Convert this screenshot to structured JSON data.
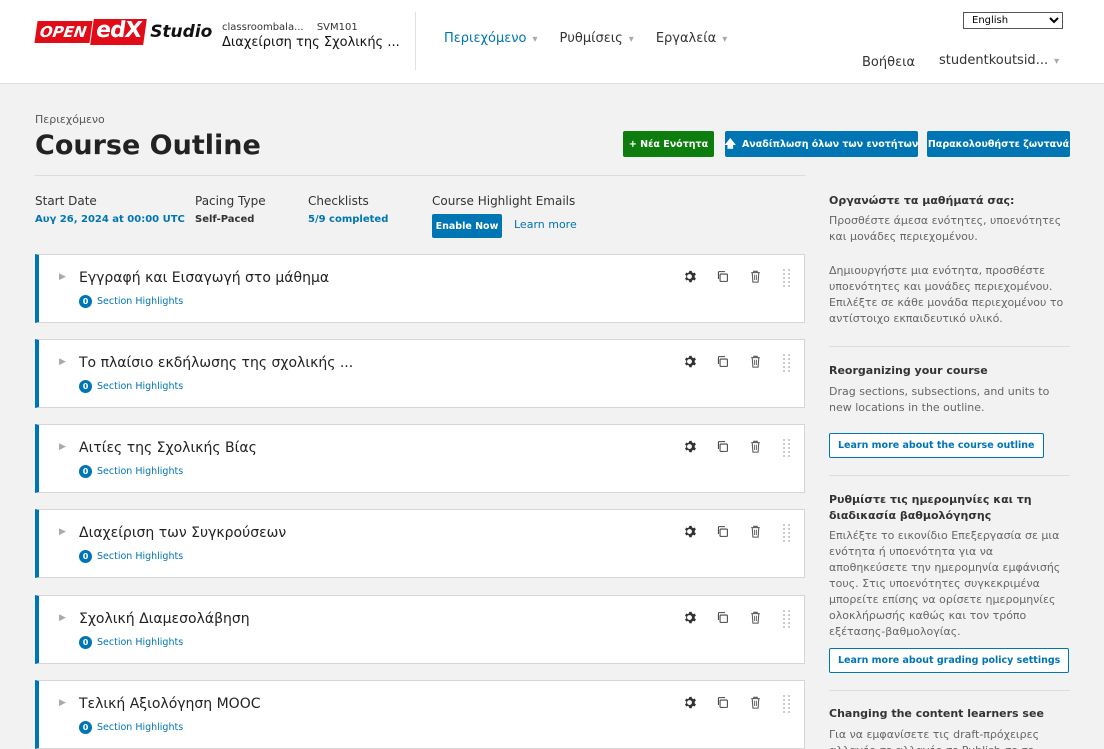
{
  "header": {
    "logo": {
      "open": "OPEN",
      "edx": "edX",
      "studio": "Studio"
    },
    "course_org": "classroombala...",
    "course_number": "SVM101",
    "course_title": "Διαχείριση της Σχολικής ...",
    "nav": [
      {
        "label": "Περιεχόμενο"
      },
      {
        "label": "Ρυθμίσεις"
      },
      {
        "label": "Εργαλεία"
      }
    ],
    "language": "English",
    "help": "Βοήθεια",
    "user": "studentkoutsid..."
  },
  "page": {
    "breadcrumb": "Περιεχόμενο",
    "title": "Course Outline",
    "new_section_btn": "+ Νέα Ενότητα",
    "collapse_all_btn": "Αναδίπλωση όλων των ενοτήτων",
    "view_live_btn": "Παρακολουθήστε ζωντανά"
  },
  "status": {
    "start_date_label": "Start Date",
    "start_date_value": "Αυγ 26, 2024 at 00:00 UTC",
    "pacing_label": "Pacing Type",
    "pacing_value": "Self-Paced",
    "checklists_label": "Checklists",
    "checklists_value": "5/9 completed",
    "highlight_label": "Course Highlight Emails",
    "enable_now": "Enable Now",
    "learn_more": "Learn more"
  },
  "sections": [
    {
      "title": "Εγγραφή και Εισαγωγή στο μάθημα",
      "highlights_count": "0",
      "highlights_label": "Section Highlights"
    },
    {
      "title": "Το πλαίσιο εκδήλωσης της σχολικής ...",
      "highlights_count": "0",
      "highlights_label": "Section Highlights"
    },
    {
      "title": "Αιτίες της Σχολικής Βίας",
      "highlights_count": "0",
      "highlights_label": "Section Highlights"
    },
    {
      "title": "Διαχείριση των Συγκρούσεων",
      "highlights_count": "0",
      "highlights_label": "Section Highlights"
    },
    {
      "title": "Σχολική Διαμεσολάβηση",
      "highlights_count": "0",
      "highlights_label": "Section Highlights"
    },
    {
      "title": "Τελική Αξιολόγηση MOOC",
      "highlights_count": "0",
      "highlights_label": "Section Highlights"
    }
  ],
  "sidebar": {
    "organize_title": "Οργανώστε τα μαθήματά σας:",
    "organize_p1": "Προσθέστε άμεσα ενότητες, υποενότητες και μονάδες περιεχομένου.",
    "organize_p2": "Δημιουργήστε μια ενότητα, προσθέστε υποενότητες και μονάδες περιεχομένου. Επιλέξτε σε κάθε μονάδα περιεχομένου το αντίστοιχο εκπαιδευτικό υλικό.",
    "reorg_title": "Reorganizing your course",
    "reorg_p": "Drag sections, subsections, and units to new locations in the outline.",
    "reorg_btn": "Learn more about the course outline",
    "dates_title": "Ρυθμίστε τις ημερομηνίες και τη διαδικασία βαθμολόγησης",
    "dates_p": "Επιλέξτε το εικονίδιο Επεξεργασία σε μια ενότητα ή υποενότητα για να αποθηκεύσετε την ημερομηνία εμφάνισής τους. Στις υποενότητες συγκεκριμένα μπορείτε επίσης να ορίσετε ημερομηνίες ολοκλήρωσής καθώς και τον τρόπο εξέτασης-βαθμολογίας.",
    "dates_btn": "Learn more about grading policy settings",
    "changing_title": "Changing the content learners see",
    "changing_p": "Για να εμφανίσετε τις draft-πρόχειρες αλλαγές σε αλλαγές σε Publish σε σε"
  },
  "colors": {
    "accent": "#0075b4",
    "success": "#0d7d0d",
    "brand": "#e20b18"
  }
}
